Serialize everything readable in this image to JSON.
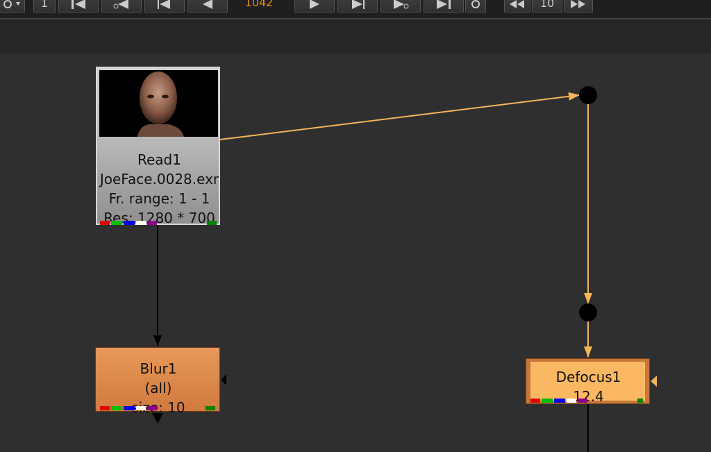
{
  "toolbar": {
    "frame_start": "1",
    "current_frame": "1042",
    "increment": "10"
  },
  "nodes": {
    "read": {
      "name": "Read1",
      "file": "JoeFace.0028.exr",
      "frame_range": "Fr. range: 1 - 1",
      "resolution": "Res: 1280 * 700"
    },
    "blur": {
      "name": "Blur1",
      "channels": "(all)",
      "size": "size: 10"
    },
    "defocus": {
      "name": "Defocus1",
      "value": "12.4"
    }
  },
  "colors": {
    "edge_default": "#000000",
    "edge_selected": "#f5b55a",
    "blur_node": "#d98a4c",
    "defocus_node": "#fbb862",
    "frame_text": "#e88a1a"
  }
}
